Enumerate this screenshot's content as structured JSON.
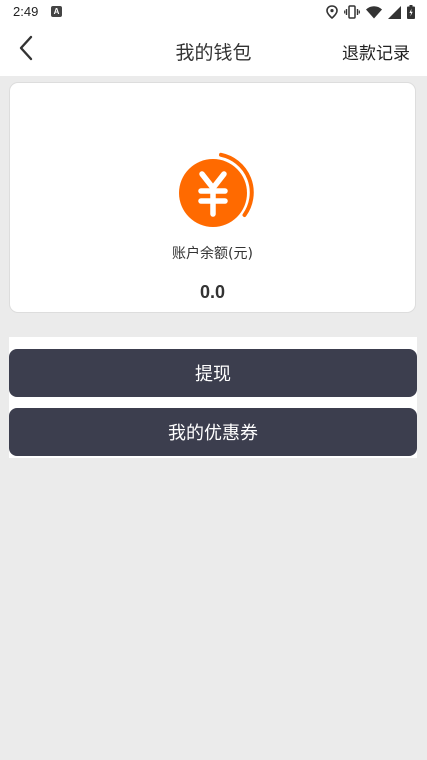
{
  "status_bar": {
    "time": "2:49",
    "icons": [
      "a-notification-icon",
      "location-icon",
      "vibrate-icon",
      "wifi-icon",
      "signal-icon",
      "battery-icon"
    ]
  },
  "header": {
    "back_icon": "chevron-left-icon",
    "title": "我的钱包",
    "refund_link": "退款记录"
  },
  "balance": {
    "icon": "yen-icon",
    "label": "账户余额(元)",
    "value": "0.0"
  },
  "actions": {
    "withdraw_label": "提现",
    "coupons_label": "我的优惠券"
  },
  "colors": {
    "accent": "#ff6a00",
    "button_bg": "#3c3e4e",
    "page_bg": "#ebebeb"
  }
}
